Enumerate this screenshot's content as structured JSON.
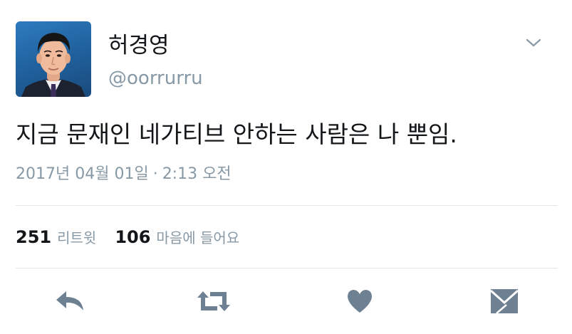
{
  "top_clip_text": "· · · ·  ·  ·  ·  ·",
  "tweet": {
    "display_name": "허경영",
    "username": "@oorrurru",
    "text": "지금 문재인 네가티브 안하는 사람은 나 뿐임.",
    "date": "2017년 04월 01일",
    "separator": "·",
    "time": "2:13 오전",
    "retweets": {
      "count": "251",
      "label": "리트윗"
    },
    "likes": {
      "count": "106",
      "label": "마음에 들어요"
    }
  },
  "icons": {
    "caret": "chevron-down-icon",
    "reply": "reply-icon",
    "retweet": "retweet-icon",
    "like": "heart-icon",
    "dm": "envelope-icon"
  },
  "colors": {
    "text": "#14171a",
    "muted": "#8899a6",
    "icon": "#6e8193",
    "divider": "#e1e8ed"
  }
}
